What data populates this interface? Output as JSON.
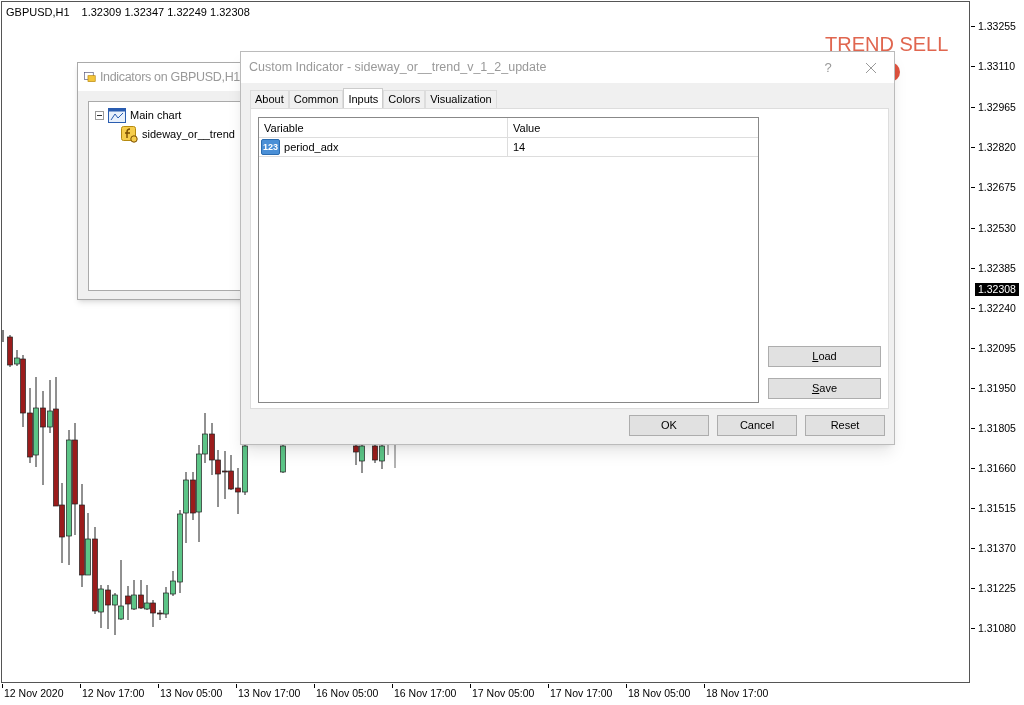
{
  "chart": {
    "symbol": "GBPUSD,H1",
    "ohlc": "1.32309 1.32347 1.32249 1.32308",
    "signal_text": "TREND SELL",
    "price_labels": [
      "1.33255",
      "1.33110",
      "1.32965",
      "1.32820",
      "1.32675",
      "1.32530",
      "1.32385",
      "1.32240",
      "1.32095",
      "1.31950",
      "1.31805",
      "1.31660",
      "1.31515",
      "1.31370",
      "1.31225",
      "1.31080"
    ],
    "current_price": "1.32308",
    "time_labels": [
      "12 Nov 2020",
      "12 Nov 17:00",
      "13 Nov 05:00",
      "13 Nov 17:00",
      "16 Nov 05:00",
      "16 Nov 17:00",
      "17 Nov 05:00",
      "17 Nov 17:00",
      "18 Nov 05:00",
      "18 Nov 17:00"
    ]
  },
  "indicators_window": {
    "title": "Indicators on GBPUSD,H1",
    "tree": [
      {
        "label": "Main chart",
        "expanded": true,
        "children": [
          {
            "label": "sideway_or__trend"
          }
        ]
      }
    ]
  },
  "dialog": {
    "title": "Custom Indicator - sideway_or__trend_v_1_2_update",
    "help": "?",
    "tabs": [
      {
        "label": "About",
        "selected": false
      },
      {
        "label": "Common",
        "selected": false
      },
      {
        "label": "Inputs",
        "selected": true
      },
      {
        "label": "Colors",
        "selected": false
      },
      {
        "label": "Visualization",
        "selected": false
      }
    ],
    "table": {
      "columns": [
        "Variable",
        "Value"
      ],
      "rows": [
        {
          "type_badge": "123",
          "variable": "period_adx",
          "value": "14"
        }
      ]
    },
    "side_buttons": [
      "Load",
      "Save"
    ],
    "footer_buttons": [
      "OK",
      "Cancel",
      "Reset"
    ]
  }
}
